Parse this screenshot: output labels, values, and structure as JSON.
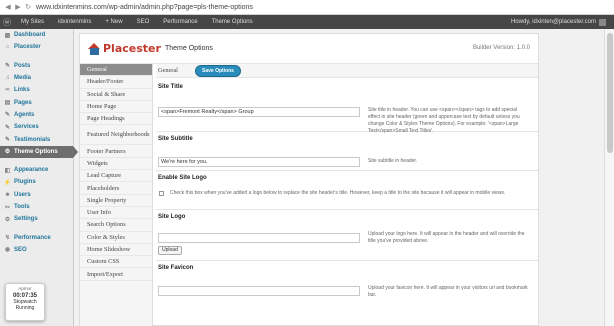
{
  "browser": {
    "url": "www.idxintenmins.com/wp-admin/admin.php?page=pls-theme-options"
  },
  "adminbar": {
    "my_sites": "My Sites",
    "site": "idxintenmins",
    "new": "+ New",
    "seo": "SEO",
    "performance": "Performance",
    "theme_options": "Theme Options",
    "howdy": "Howdy, idxinten@placester.com"
  },
  "sidebar": {
    "items": [
      {
        "label": "Dashboard",
        "icon": "dashboard-icon"
      },
      {
        "label": "Placester",
        "icon": "placester-icon"
      },
      {
        "label": "Posts",
        "icon": "pin-icon"
      },
      {
        "label": "Media",
        "icon": "media-icon"
      },
      {
        "label": "Links",
        "icon": "link-icon"
      },
      {
        "label": "Pages",
        "icon": "page-icon"
      },
      {
        "label": "Agents",
        "icon": "pin-icon"
      },
      {
        "label": "Services",
        "icon": "pin-icon"
      },
      {
        "label": "Testimonials",
        "icon": "pin-icon"
      },
      {
        "label": "Theme Options",
        "icon": "settings-icon"
      },
      {
        "label": "Appearance",
        "icon": "appearance-icon"
      },
      {
        "label": "Plugins",
        "icon": "plugin-icon"
      },
      {
        "label": "Users",
        "icon": "users-icon"
      },
      {
        "label": "Tools",
        "icon": "tools-icon"
      },
      {
        "label": "Settings",
        "icon": "settings-icon"
      },
      {
        "label": "Performance",
        "icon": "performance-icon"
      },
      {
        "label": "SEO",
        "icon": "seo-icon"
      }
    ]
  },
  "stopwatch": {
    "header": "Apmor",
    "time": "00:07:35",
    "line1": "Stopwatch",
    "line2": "Running"
  },
  "panel": {
    "brand": "Placester",
    "title": "Theme Options",
    "version": "Builder Version: 1.0.0",
    "current_tab": "General",
    "save_label": "Save Options"
  },
  "tabs": [
    "General",
    "Header/Footer",
    "Social & Share",
    "Home Page",
    "Page Headings",
    "Featured Neighborhoods",
    "Footer Partners",
    "Widgets",
    "Lead Capture",
    "Placeholders",
    "Single Property",
    "User Info",
    "Search Options",
    "Color & Styles",
    "Home Slideshow",
    "Custom CSS",
    "Import/Export"
  ],
  "fields": {
    "site_title": {
      "label": "Site Title",
      "value": "<span>Fremont Realty</span> Group",
      "help": "Site title in header. You can use <span></span> tags to add special effect in site header (green and uppercase text by default unless you change Color & Styles Theme Options). For example: '<span>Large Text</span>Small Text Titles'."
    },
    "site_subtitle": {
      "label": "Site Subtitle",
      "value": "We're here for you.",
      "help": "Site subtitle in header."
    },
    "enable_logo": {
      "label": "Enable Site Logo",
      "desc": "Check this box when you've added a logo below to replace the site header's title. However, keep a title to the site because it will appear in mobile views."
    },
    "site_logo": {
      "label": "Site Logo",
      "help": "Upload your logo here. It will appear in the header and will override the title you've provided above.",
      "upload": "Upload"
    },
    "site_favicon": {
      "label": "Site Favicon",
      "help": "Upload your favicon here. It will appear in your visitors url and bookmark bar."
    }
  }
}
